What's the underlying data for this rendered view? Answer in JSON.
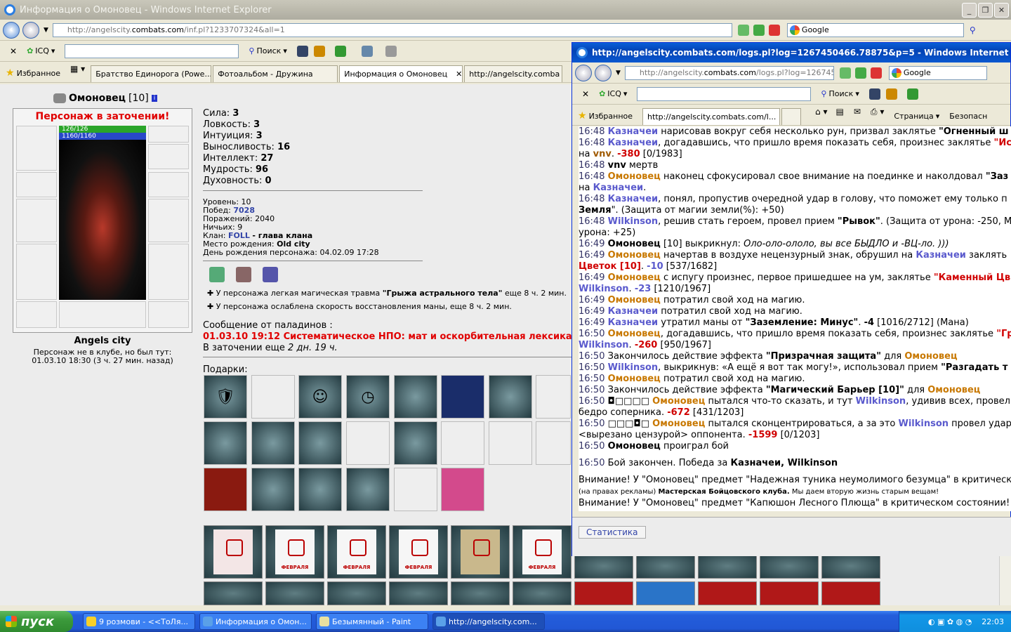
{
  "main_window": {
    "title": "Информация о Омоновец - Windows Internet Explorer",
    "address": {
      "prefix": "http://angelscity.",
      "host": "combats.com",
      "rest": "/inf.pl?1233707324&all=1"
    },
    "search_placeholder": "Google",
    "toolbar": {
      "icq": "ICQ",
      "search": "Поиск"
    },
    "favorites_label": "Избранное",
    "tabs": [
      "Братство Единорога (Powe...",
      "Фотоальбом - Дружина",
      "Информация о Омоновец",
      "http://angelscity.comba"
    ]
  },
  "character": {
    "name": "Омоновец",
    "level_tag": "[10]",
    "jail_banner": "Персонаж в заточении!",
    "hp": "126/126",
    "mana": "1160/1160",
    "city": "Angels city",
    "status_line1": "Персонаж не в клубе, но был тут:",
    "status_line2": "01.03.10 18:30 (3 ч. 27 мин. назад)",
    "stats": [
      {
        "label": "Сила:",
        "value": "3"
      },
      {
        "label": "Ловкость:",
        "value": "3"
      },
      {
        "label": "Интуиция:",
        "value": "3"
      },
      {
        "label": "Выносливость:",
        "value": "16"
      },
      {
        "label": "Интеллект:",
        "value": "27"
      },
      {
        "label": "Мудрость:",
        "value": "96"
      },
      {
        "label": "Духовность:",
        "value": "0"
      }
    ],
    "info": {
      "level_label": "Уровень:",
      "level": "10",
      "wins_label": "Побед:",
      "wins": "7028",
      "losses_label": "Поражений:",
      "losses": "2040",
      "draws_label": "Ничьих:",
      "draws": "9",
      "clan_label": "Клан:",
      "clan": "FOLL",
      "clan_role": "- глава клана",
      "birthplace_label": "Место рождения:",
      "birthplace": "Old city",
      "birthday": "День рождения персонажа: 04.02.09 17:28"
    },
    "effects": [
      {
        "pre": "У персонажа легкая магическая травма ",
        "name": "\"Грыжа астрального тела\"",
        "post": " еще 8 ч. 2 мин."
      },
      {
        "pre": "У персонажа ослаблена скорость восстановления маны, еще 8 ч. 2 мин.",
        "name": "",
        "post": ""
      }
    ],
    "paladin_msg_label": "Сообщение от паладинов :",
    "paladin_msg": "01.03.10 19:12 Систематическое НПО: мат и оскорбительная лексика",
    "jail_time_pre": "В заточении еще ",
    "jail_time": "2 дн. 19 ч.",
    "gifts_label": "Подарки:",
    "card_text": "ФЕВРАЛЯ"
  },
  "log_window": {
    "title": "http://angelscity.combats.com/logs.pl?log=1267450466.78875&p=5 - Windows Internet Explore",
    "address": {
      "prefix": "http://angelscity.",
      "host": "combats.com",
      "rest": "/logs.pl?log=1267450466"
    },
    "search_placeholder": "Google",
    "toolbar": {
      "icq": "ICQ",
      "search": "Поиск"
    },
    "favorites_label": "Избранное",
    "tab": "http://angelscity.combats.com/l...",
    "cmd": {
      "page": "Страница",
      "safety": "Безопасн"
    },
    "stats_button": "Статистика",
    "lines": [
      [
        [
          "t",
          "16:48 "
        ],
        [
          "blue b",
          "Казначеи"
        ],
        [
          "",
          "  нарисовав вокруг себя несколько рун, призвал заклятье "
        ],
        [
          "b",
          "\"Огненный ш"
        ]
      ],
      [
        [
          "t",
          "16:48 "
        ],
        [
          "blue b",
          "Казначеи"
        ],
        [
          "",
          ", догадавшись, что пришло время показать себя, произнес заклятье "
        ],
        [
          "red b",
          "\"Ис"
        ]
      ],
      [
        [
          "",
          "на "
        ],
        [
          "brown b",
          "vnv"
        ],
        [
          "",
          ". "
        ],
        [
          "red b",
          "-380"
        ],
        [
          "",
          " [0/1983]"
        ]
      ],
      [
        [
          "t",
          "16:48 "
        ],
        [
          "b",
          "vnv"
        ],
        [
          "",
          " мертв"
        ]
      ],
      [
        [
          "t",
          "16:48 "
        ],
        [
          "orange b",
          "Омоновец"
        ],
        [
          "",
          " наконец сфокусировал свое внимание на поединке и наколдовал "
        ],
        [
          "b",
          "\"Заз"
        ]
      ],
      [
        [
          "",
          "на "
        ],
        [
          "blue b",
          "Казначеи"
        ],
        [
          "",
          "."
        ]
      ],
      [
        [
          "t",
          "16:48 "
        ],
        [
          "blue b",
          "Казначеи"
        ],
        [
          "",
          ", понял, пропустив очередной удар в голову, что поможет ему только п"
        ]
      ],
      [
        [
          "b",
          "Земля"
        ],
        [
          "",
          "\". (Защита от магии земли(%): +50)"
        ]
      ],
      [
        [
          "t",
          "16:48 "
        ],
        [
          "blue b",
          "Wilkinson"
        ],
        [
          "",
          ", решив стать героем, провел прием "
        ],
        [
          "b",
          "\"Рывок\""
        ],
        [
          "",
          ". (Защита от урона: -250, М"
        ]
      ],
      [
        [
          "",
          "урона: +25)"
        ]
      ],
      [
        [
          "t",
          "16:49 "
        ],
        [
          "b",
          "Омоновец"
        ],
        [
          "",
          " [10] выкрикнул: "
        ],
        [
          "i",
          "Оло-оло-ололо, вы все БЫДЛО и -ВЦ-ло. )))"
        ]
      ],
      [
        [
          "t",
          "16:49 "
        ],
        [
          "orange b",
          "Омоновец"
        ],
        [
          "",
          " начертав в воздухе нецензурный знак, обрушил на "
        ],
        [
          "blue b",
          "Казначеи"
        ],
        [
          "",
          " заклять"
        ]
      ],
      [
        [
          "red b",
          "Цветок [10]"
        ],
        [
          "",
          ". "
        ],
        [
          "blue b",
          "-10"
        ],
        [
          "",
          " [537/1682]"
        ]
      ],
      [
        [
          "t",
          "16:49 "
        ],
        [
          "orange b",
          "Омоновец"
        ],
        [
          "",
          " с испугу произнес, первое пришедшее на ум, заклятье "
        ],
        [
          "red b",
          "\"Каменный Цв"
        ]
      ],
      [
        [
          "blue b",
          "Wilkinson"
        ],
        [
          "",
          ". "
        ],
        [
          "blue b",
          "-23"
        ],
        [
          "",
          " [1210/1967]"
        ]
      ],
      [
        [
          "t",
          "16:49 "
        ],
        [
          "orange b",
          "Омоновец"
        ],
        [
          "",
          " потратил свой ход на магию."
        ]
      ],
      [
        [
          "t",
          "16:49 "
        ],
        [
          "blue b",
          "Казначеи"
        ],
        [
          "",
          " потратил свой ход на магию."
        ]
      ],
      [
        [
          "t",
          "16:49 "
        ],
        [
          "blue b",
          "Казначеи"
        ],
        [
          "",
          " утратил маны от "
        ],
        [
          "b",
          "\"Заземление: Минус\""
        ],
        [
          "",
          ". "
        ],
        [
          "b",
          "-4"
        ],
        [
          "",
          " [1016/2712] (Мана)"
        ]
      ],
      [
        [
          "t",
          "16:50 "
        ],
        [
          "orange b",
          "Омоновец"
        ],
        [
          "",
          ", догадавшись, что пришло время показать себя, произнес заклятье "
        ],
        [
          "red b",
          "\"Гр"
        ]
      ],
      [
        [
          "blue b",
          "Wilkinson"
        ],
        [
          "",
          ". "
        ],
        [
          "red b",
          "-260"
        ],
        [
          "",
          " [950/1967]"
        ]
      ],
      [
        [
          "t",
          "16:50 "
        ],
        [
          "",
          " Закончилось действие эффекта "
        ],
        [
          "b",
          "\"Призрачная защита\""
        ],
        [
          "",
          " для "
        ],
        [
          "orange b",
          "Омоновец"
        ]
      ],
      [
        [
          "t",
          "16:50 "
        ],
        [
          "blue b",
          "Wilkinson"
        ],
        [
          "",
          ", выкрикнув: «А ещё я вот так могу!», использовал прием "
        ],
        [
          "b",
          "\"Разгадать т"
        ]
      ],
      [
        [
          "t",
          "16:50 "
        ],
        [
          "orange b",
          "Омоновец"
        ],
        [
          "",
          " потратил свой ход на магию."
        ]
      ],
      [
        [
          "t",
          "16:50 "
        ],
        [
          "",
          " Закончилось действие эффекта "
        ],
        [
          "b",
          "\"Магический Барьер [10]\""
        ],
        [
          "",
          " для "
        ],
        [
          "orange b",
          "Омоновец"
        ]
      ],
      [
        [
          "t",
          "16:50 "
        ],
        [
          "",
          "◘□□□□ "
        ],
        [
          "orange b",
          "Омоновец"
        ],
        [
          "",
          " пытался что-то сказать, и тут "
        ],
        [
          "blue b",
          "Wilkinson"
        ],
        [
          "",
          ", удивив всех, провел"
        ]
      ],
      [
        [
          "",
          "бедро соперника. "
        ],
        [
          "red b",
          "-672"
        ],
        [
          "",
          " [431/1203]"
        ]
      ],
      [
        [
          "t",
          "16:50 "
        ],
        [
          "",
          "□□□◘□ "
        ],
        [
          "orange b",
          "Омоновец"
        ],
        [
          "",
          " пытался сконцентрироваться, а за это "
        ],
        [
          "blue b",
          "Wilkinson"
        ],
        [
          "",
          " провел удар"
        ]
      ],
      [
        [
          "",
          "<вырезано цензурой> оппонента. "
        ],
        [
          "red b",
          "-1599"
        ],
        [
          "",
          " [0/1203]"
        ]
      ],
      [
        [
          "t",
          "16:50 "
        ],
        [
          "b",
          "Омоновец"
        ],
        [
          "",
          " проиграл бой"
        ]
      ],
      [
        [
          "",
          ""
        ]
      ],
      [
        [
          "t",
          "16:50 "
        ],
        [
          "",
          "Бой закончен. Победа за "
        ],
        [
          "b",
          "Казначеи, Wilkinson"
        ]
      ],
      [
        [
          "",
          ""
        ]
      ],
      [
        [
          "",
          "Внимание! У \"Омоновец\" предмет \"Надежная туника неумолимого безумца\" в критическо"
        ]
      ],
      [
        [
          "s",
          "(на правах рекламы) "
        ],
        [
          "sb",
          "Мастерская Бойцовского клуба."
        ],
        [
          "s",
          " Мы даем вторую жизнь старым вещам!"
        ]
      ],
      [
        [
          "",
          "Внимание! У \"Омоновец\" предмет \"Капюшон Лесного Плюща\" в критическом состоянии!"
        ]
      ],
      [
        [
          "s",
          "(на правах рекламы) "
        ],
        [
          "sb",
          "Мастерская Бойцовского клуба."
        ],
        [
          "s",
          " Мы даем вторую жизнь старым вещам!"
        ]
      ]
    ]
  },
  "taskbar": {
    "start": "пуск",
    "tasks": [
      "9 розмови - <<ТоЛя...",
      "Информация о Омон...",
      "Безымянный - Paint",
      "http://angelscity.com..."
    ],
    "lang": "RU",
    "clock": "22:03"
  },
  "colors": {
    "accent": "#0343b5",
    "jail_red": "#e00000",
    "hp_green": "#2aa52a",
    "mana_blue": "#2848c8"
  }
}
